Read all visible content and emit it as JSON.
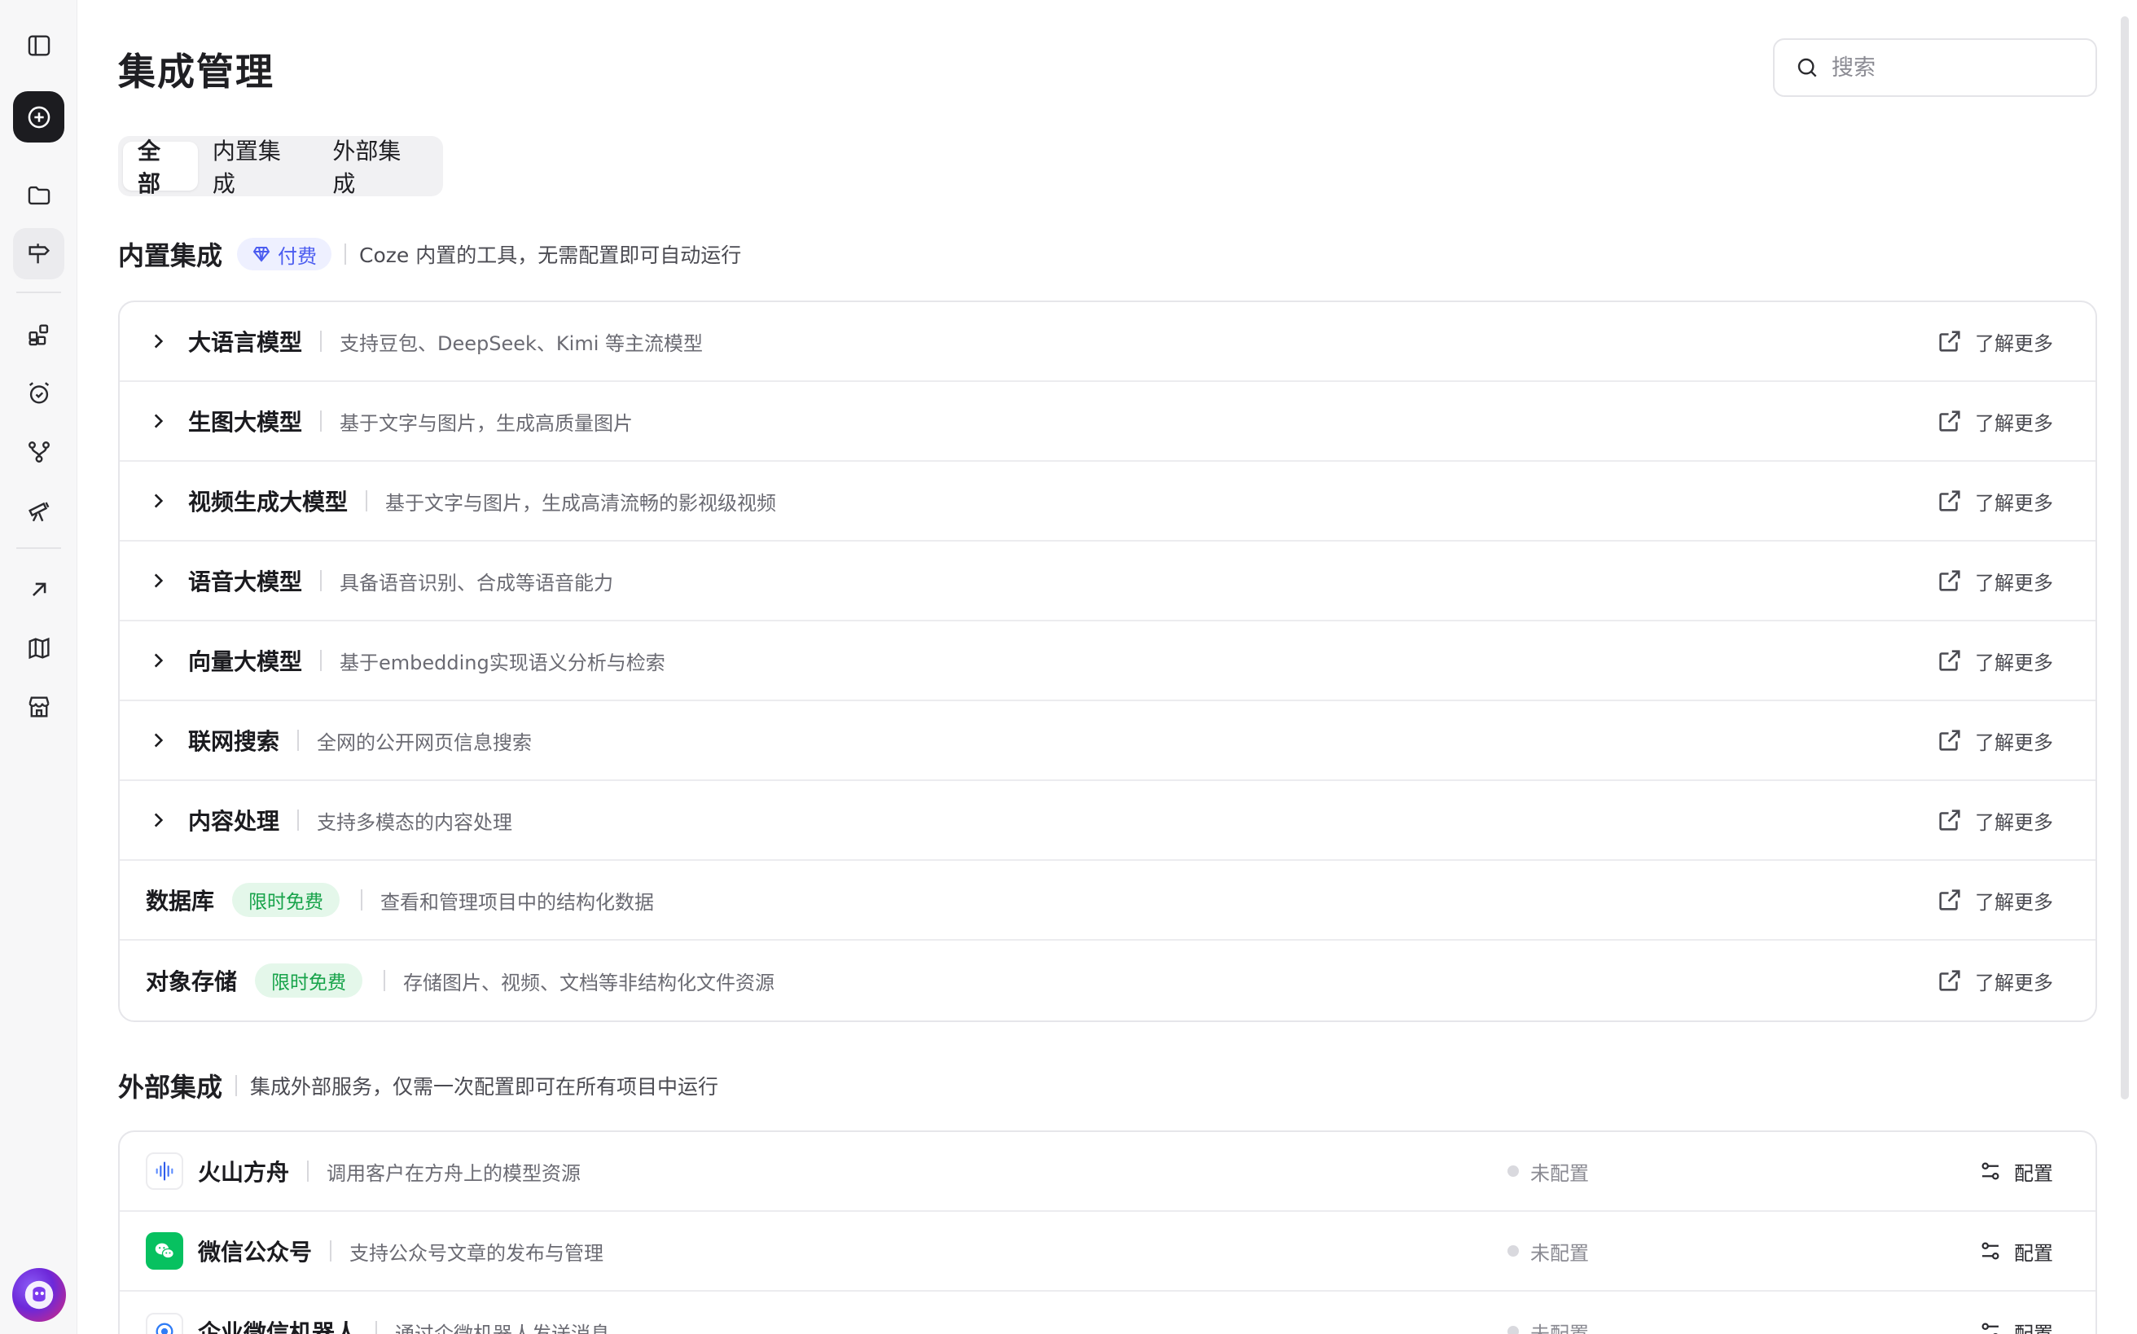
{
  "page": {
    "title": "集成管理"
  },
  "search": {
    "placeholder": "搜索"
  },
  "tabs": [
    {
      "label": "全部",
      "active": true
    },
    {
      "label": "内置集成",
      "active": false
    },
    {
      "label": "外部集成",
      "active": false
    }
  ],
  "builtin": {
    "title": "内置集成",
    "badge": "付费",
    "desc": "Coze 内置的工具，无需配置即可自动运行",
    "learn_more": "了解更多",
    "items": [
      {
        "title": "大语言模型",
        "desc": "支持豆包、DeepSeek、Kimi 等主流模型",
        "expandable": true
      },
      {
        "title": "生图大模型",
        "desc": "基于文字与图片，生成高质量图片",
        "expandable": true
      },
      {
        "title": "视频生成大模型",
        "desc": "基于文字与图片，生成高清流畅的影视级视频",
        "expandable": true
      },
      {
        "title": "语音大模型",
        "desc": "具备语音识别、合成等语音能力",
        "expandable": true
      },
      {
        "title": "向量大模型",
        "desc": "基于embedding实现语义分析与检索",
        "expandable": true
      },
      {
        "title": "联网搜索",
        "desc": "全网的公开网页信息搜索",
        "expandable": true
      },
      {
        "title": "内容处理",
        "desc": "支持多模态的内容处理",
        "expandable": true
      },
      {
        "title": "数据库",
        "badge": "限时免费",
        "desc": "查看和管理项目中的结构化数据",
        "expandable": false
      },
      {
        "title": "对象存储",
        "badge": "限时免费",
        "desc": "存储图片、视频、文档等非结构化文件资源",
        "expandable": false
      }
    ]
  },
  "external": {
    "title": "外部集成",
    "desc": "集成外部服务，仅需一次配置即可在所有项目中运行",
    "items": [
      {
        "icon": "volcano-ark-icon",
        "title": "火山方舟",
        "desc": "调用客户在方舟上的模型资源",
        "status": "未配置",
        "action": "配置"
      },
      {
        "icon": "wechat-official-icon",
        "title": "微信公众号",
        "desc": "支持公众号文章的发布与管理",
        "status": "未配置",
        "action": "配置"
      },
      {
        "icon": "wecom-bot-icon",
        "title": "企业微信机器人",
        "desc": "通过企微机器人发送消息",
        "status": "未配置",
        "action": "配置"
      }
    ]
  },
  "colors": {
    "accent_paid": "#4b5cf0",
    "free_badge": "#17a34a",
    "wechat_green": "#07c160"
  }
}
